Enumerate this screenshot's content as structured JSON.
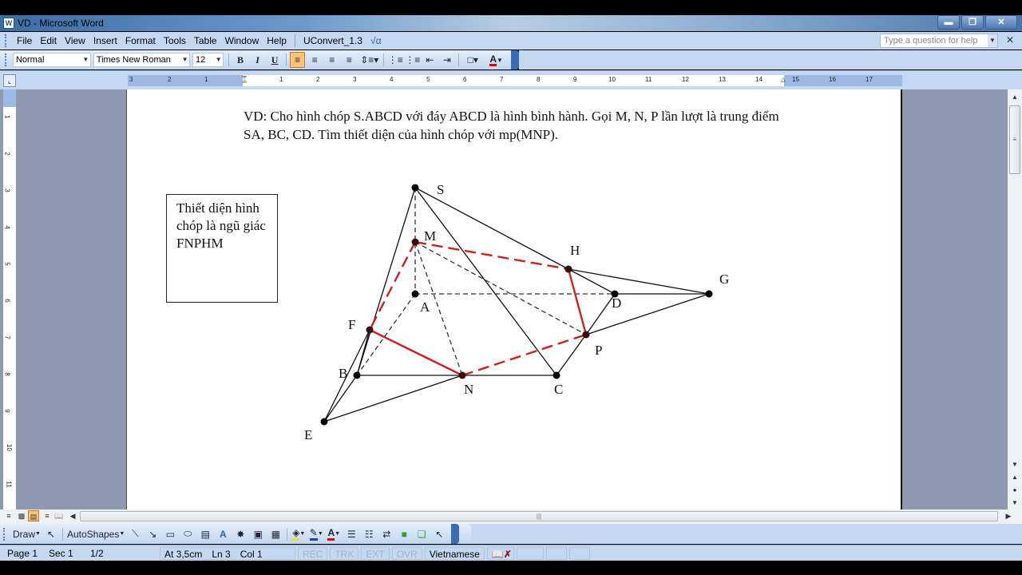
{
  "window": {
    "title": "VD - Microsoft Word",
    "app_icon": "word-icon",
    "controls": {
      "minimize": "minimize-icon",
      "restore": "restore-icon",
      "close": "close-icon"
    }
  },
  "menubar": {
    "items": [
      {
        "label": "File",
        "accel": "F"
      },
      {
        "label": "Edit",
        "accel": "E"
      },
      {
        "label": "View",
        "accel": "V"
      },
      {
        "label": "Insert",
        "accel": "I"
      },
      {
        "label": "Format",
        "accel": "o"
      },
      {
        "label": "Tools",
        "accel": "T"
      },
      {
        "label": "Table",
        "accel": "a"
      },
      {
        "label": "Window",
        "accel": "W"
      },
      {
        "label": "Help",
        "accel": "H"
      }
    ],
    "addin": "UConvert_1.3",
    "equation_symbol": "√α",
    "help_placeholder": "Type a question for help"
  },
  "formatting_toolbar": {
    "style": "Normal",
    "font": "Times New Roman",
    "size": "12",
    "bold": "B",
    "italic": "I",
    "underline": "U",
    "alignment_active": "align-left"
  },
  "ruler": {
    "horizontal_left_labels": [
      "3",
      "2",
      "1"
    ],
    "horizontal_labels": [
      "1",
      "2",
      "3",
      "4",
      "5",
      "6",
      "7",
      "8",
      "9",
      "10",
      "11",
      "12",
      "13",
      "14",
      "15",
      "16",
      "17"
    ],
    "vertical_labels": [
      "1",
      "2",
      "3",
      "4",
      "5",
      "6",
      "7",
      "8",
      "9",
      "10",
      "11"
    ]
  },
  "document": {
    "paragraph": "VD: Cho hình chóp S.ABCD với đáy ABCD là hình bình hành. Gọi M, N, P lần lượt là trung điểm SA, BC, CD. Tìm thiết diện của hình chóp với mp(MNP).",
    "textbox": "Thiết diện hình chóp là ngũ giác FNPHM",
    "figure": {
      "points": {
        "S": {
          "label": "S"
        },
        "M": {
          "label": "M"
        },
        "A": {
          "label": "A"
        },
        "H": {
          "label": "H"
        },
        "D": {
          "label": "D"
        },
        "G": {
          "label": "G"
        },
        "F": {
          "label": "F"
        },
        "P": {
          "label": "P"
        },
        "B": {
          "label": "B"
        },
        "N": {
          "label": "N"
        },
        "C": {
          "label": "C"
        },
        "E": {
          "label": "E"
        }
      },
      "section_color": "#cc2222",
      "section_polygon": "FNPHM"
    }
  },
  "draw_toolbar": {
    "draw_label": "Draw",
    "autoshapes_label": "AutoShapes"
  },
  "statusbar": {
    "page": "Page 1",
    "section": "Sec 1",
    "page_count": "1/2",
    "at": "At 3,5cm",
    "line": "Ln 3",
    "col": "Col 1",
    "rec": "REC",
    "trk": "TRK",
    "ext": "EXT",
    "ovr": "OVR",
    "language": "Vietnamese"
  }
}
